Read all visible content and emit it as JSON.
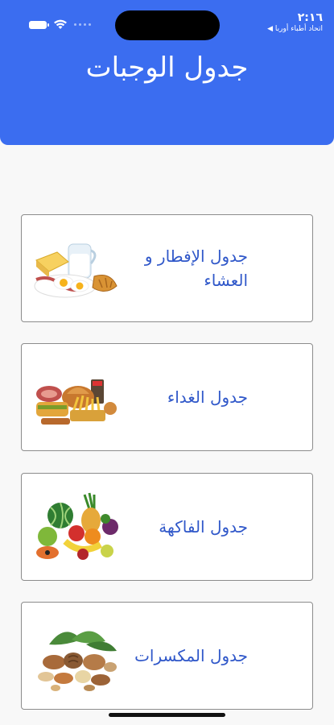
{
  "status_bar": {
    "time": "٢:١٦",
    "carrier": "◀ اتحاد أطباء أوربا"
  },
  "header": {
    "title": "جدول الوجبات",
    "color": "#3b6df0"
  },
  "cards": [
    {
      "label": "جدول الإفطار و العشاء",
      "icon": "breakfast-food-icon"
    },
    {
      "label": "جدول الغداء",
      "icon": "lunch-food-icon"
    },
    {
      "label": "جدول الفاكهة",
      "icon": "fruits-icon"
    },
    {
      "label": "جدول المكسرات",
      "icon": "nuts-icon"
    }
  ]
}
